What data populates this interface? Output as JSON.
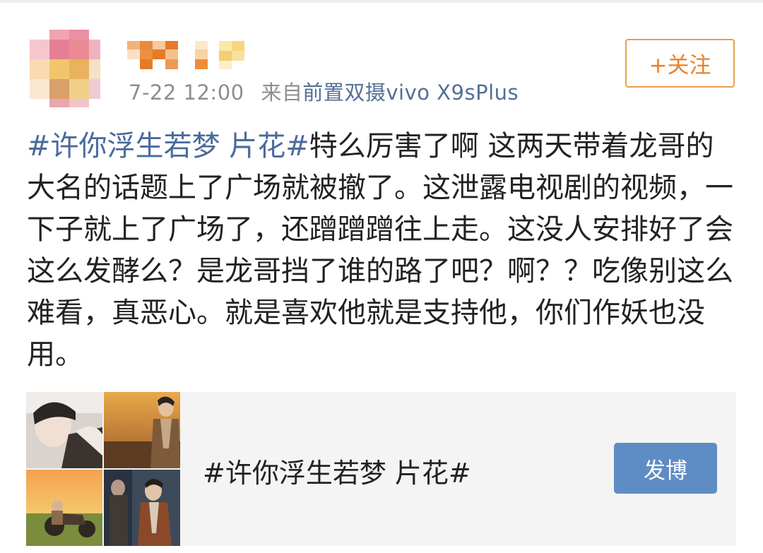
{
  "post": {
    "meta_time": "7-22 12:00",
    "meta_from": "来自",
    "meta_source": "前置双摄vivo X9sPlus",
    "follow_label": "+关注",
    "content": {
      "topic": "#许你浮生若梦 片花#",
      "text": "特么厉害了啊  这两天带着龙哥的大名的话题上了广场就被撤了。这泄露电视剧的视频，一下子就上了广场了，还蹭蹭蹭往上走。这没人安排好了会这么发酵么？是龙哥挡了谁的路了吧？啊？？吃像别这么难看，真恶心。就是喜欢他就是支持他，你们作妖也没用。"
    }
  },
  "topic_card": {
    "title": "#许你浮生若梦 片花#",
    "post_button": "发博"
  },
  "colors": {
    "link": "#4a6b9b",
    "follow": "#e9822b",
    "button": "#5e8cc4"
  }
}
